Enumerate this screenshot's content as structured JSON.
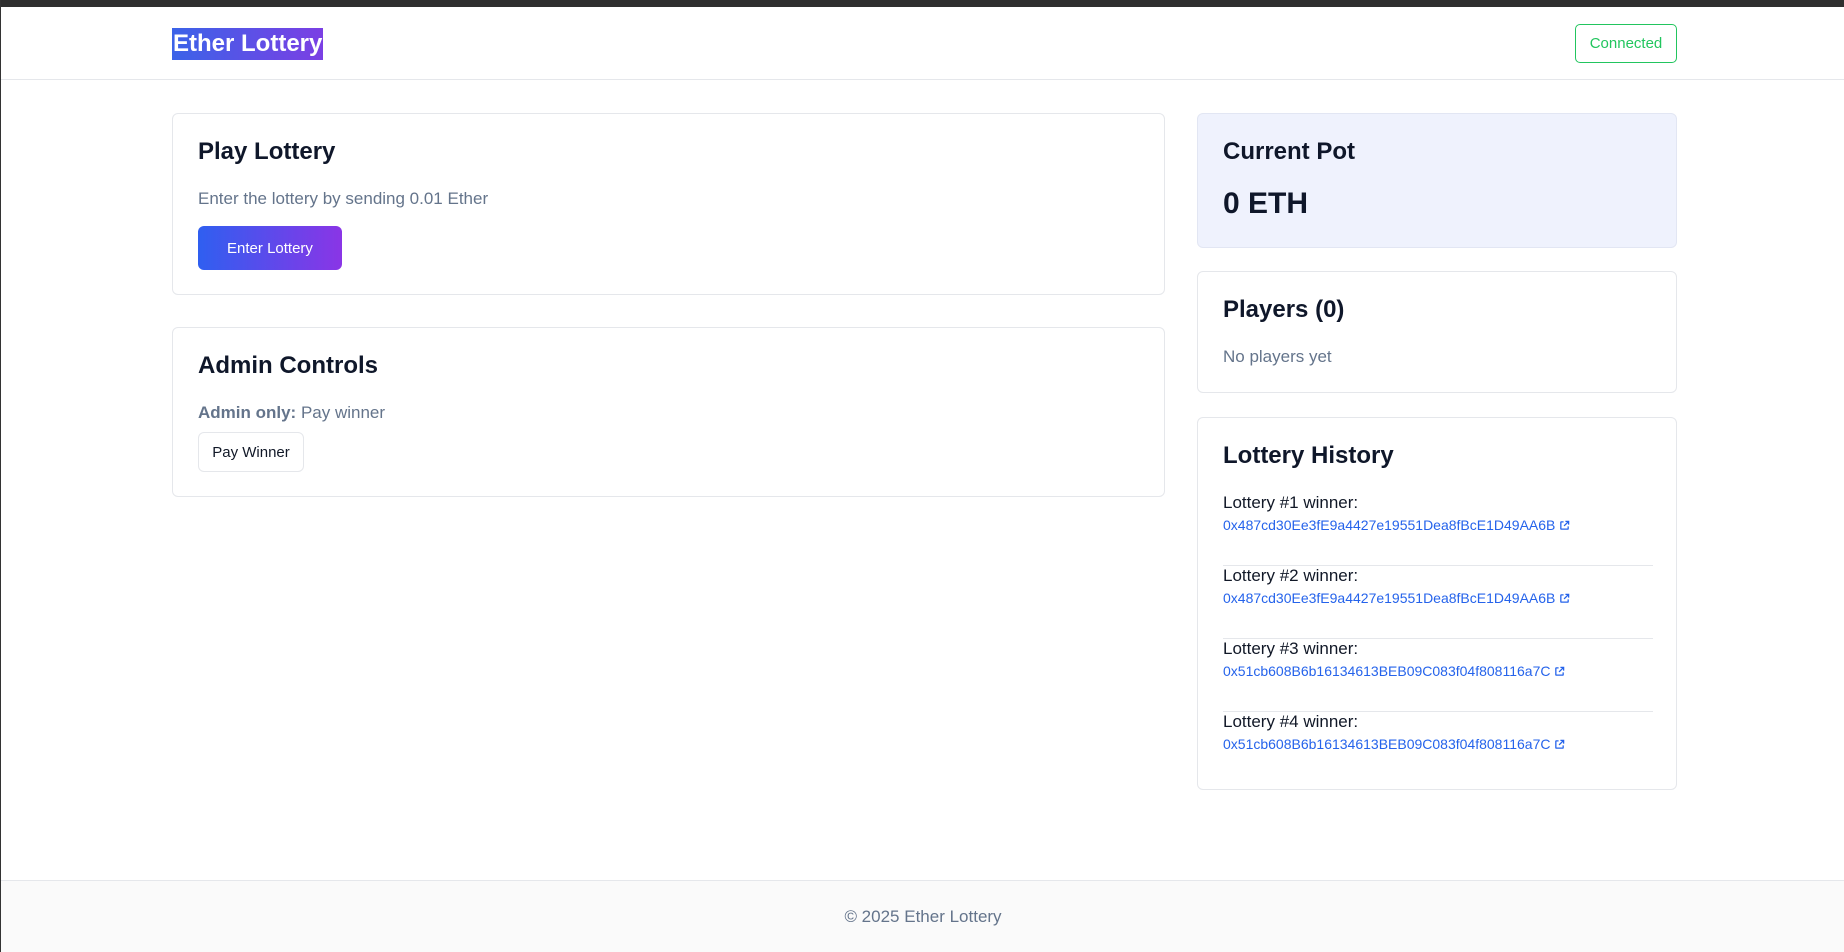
{
  "header": {
    "brand": "Ether Lottery",
    "status_button": "Connected"
  },
  "play": {
    "title": "Play Lottery",
    "description": "Enter the lottery by sending 0.01 Ether",
    "button": "Enter Lottery"
  },
  "admin": {
    "title": "Admin Controls",
    "note_label": "Admin only:",
    "note_text": " Pay winner",
    "button": "Pay Winner"
  },
  "pot": {
    "title": "Current Pot",
    "value": "0 ETH"
  },
  "players": {
    "title": "Players (0)",
    "empty": "No players yet"
  },
  "history": {
    "title": "Lottery History",
    "items": [
      {
        "label": "Lottery #1 winner:",
        "address": "0x487cd30Ee3fE9a4427e19551Dea8fBcE1D49AA6B"
      },
      {
        "label": "Lottery #2 winner:",
        "address": "0x487cd30Ee3fE9a4427e19551Dea8fBcE1D49AA6B"
      },
      {
        "label": "Lottery #3 winner:",
        "address": "0x51cb608B6b16134613BEB09C083f04f808116a7C"
      },
      {
        "label": "Lottery #4 winner:",
        "address": "0x51cb608B6b16134613BEB09C083f04f808116a7C"
      }
    ],
    "link_icon": "external-link-icon"
  },
  "footer": {
    "text": "© 2025 Ether Lottery"
  },
  "colors": {
    "accent_start": "#2f5ff0",
    "accent_end": "#8a35e6",
    "connected": "#22c55e",
    "link": "#2563eb"
  }
}
